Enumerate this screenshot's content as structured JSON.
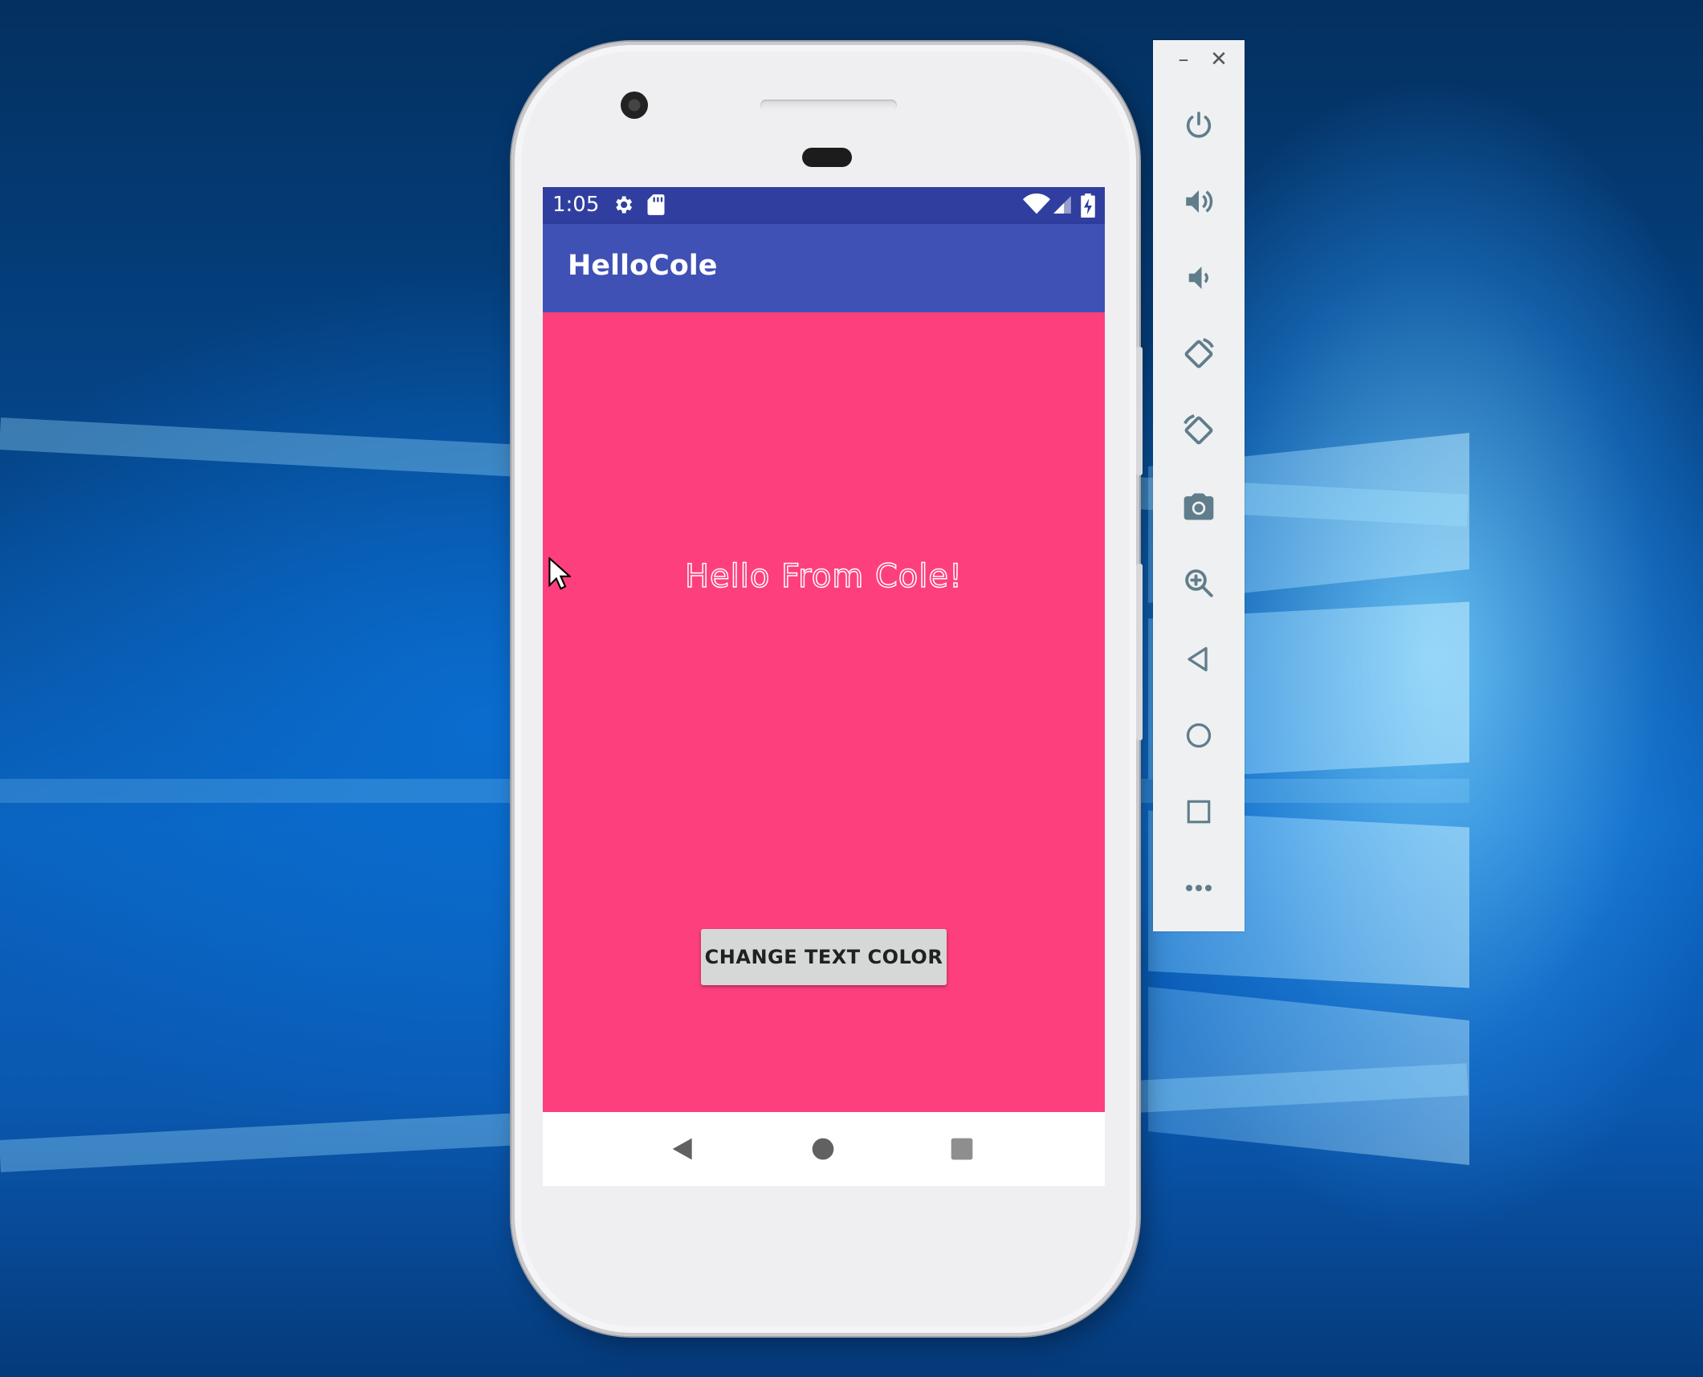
{
  "status_bar": {
    "time": "1:05",
    "icons": [
      "settings-icon",
      "sd-card-icon",
      "wifi-icon",
      "signal-icon",
      "battery-charging-icon"
    ]
  },
  "app_bar": {
    "title": "HelloCole"
  },
  "content": {
    "message": "Hello From Cole!",
    "button_label": "CHANGE TEXT COLOR",
    "background_color": "#fe3f7e",
    "text_color": "#fe3f7e",
    "text_outline_color": "#ffffff"
  },
  "nav_bar": {
    "items": [
      "back-icon",
      "home-icon",
      "recents-icon"
    ]
  },
  "emulator_toolbar": {
    "window_controls": {
      "minimize": "–",
      "close": "✕"
    },
    "buttons": [
      "power-icon",
      "volume-up-icon",
      "volume-down-icon",
      "rotate-left-icon",
      "rotate-right-icon",
      "camera-icon",
      "zoom-icon",
      "back-icon",
      "home-icon",
      "overview-icon",
      "more-icon"
    ]
  },
  "colors": {
    "status_bar": "#303f9f",
    "app_bar": "#3f51b5",
    "button": "#d6d7d7",
    "toolbar": "#eff0f1"
  }
}
